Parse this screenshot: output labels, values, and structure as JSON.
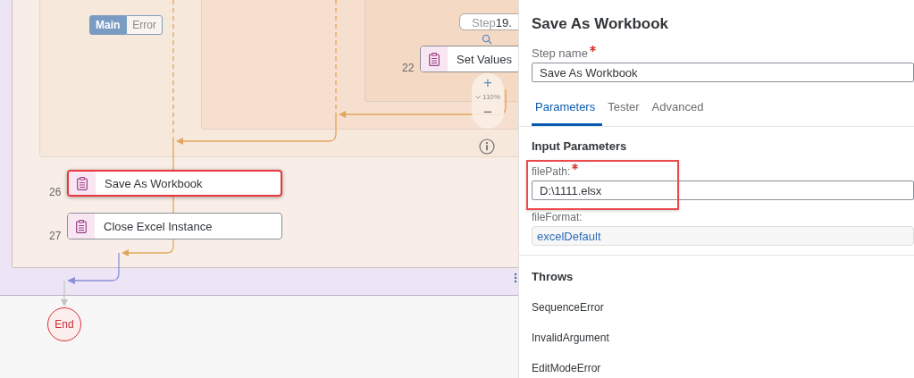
{
  "canvas": {
    "branch_toggle": [
      {
        "label": "Main",
        "selected": true
      },
      {
        "label": "Error",
        "selected": false
      }
    ],
    "step_finder": {
      "label": "Step",
      "value": "19."
    },
    "zoom": {
      "zoom_in": "+",
      "level": "110%",
      "zoom_out": "−"
    },
    "steps": [
      {
        "number": "22",
        "name": "Set Values",
        "highlighted": false
      },
      {
        "number": "26",
        "name": "Save As Workbook",
        "highlighted": true
      },
      {
        "number": "27",
        "name": "Close Excel Instance",
        "highlighted": false
      }
    ],
    "end_node": "End"
  },
  "panel": {
    "title": "Save As Workbook",
    "step_name": {
      "label": "Step name",
      "required": true,
      "value": "Save As Workbook"
    },
    "tabs": [
      {
        "label": "Parameters",
        "selected": true
      },
      {
        "label": "Tester",
        "selected": false
      },
      {
        "label": "Advanced",
        "selected": false
      }
    ],
    "input_parameters": {
      "title": "Input Parameters",
      "fields": [
        {
          "label": "filePath:",
          "required": true,
          "value": "D:\\1111.elsx",
          "kind": "text",
          "highlighted": true
        },
        {
          "label": "fileFormat:",
          "required": false,
          "value": "excelDefault",
          "kind": "enum",
          "highlighted": false
        }
      ]
    },
    "throws": {
      "title": "Throws",
      "items": [
        "SequenceError",
        "InvalidArgument",
        "EditModeError"
      ]
    }
  }
}
